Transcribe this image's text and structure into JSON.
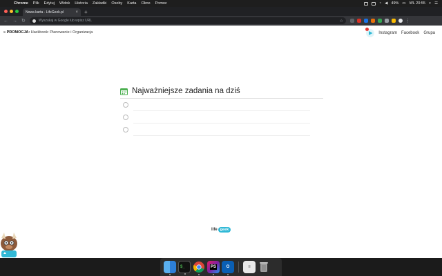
{
  "menubar": {
    "app": "Chrome",
    "items": [
      "Plik",
      "Edytuj",
      "Widok",
      "Historia",
      "Zakładki",
      "Osoby",
      "Karta",
      "Okno",
      "Pomoc"
    ],
    "battery": "49%",
    "clock": "WL 20:55"
  },
  "browser": {
    "tab_title": "Nowa karta - LifeGeek.pl",
    "omnibox_placeholder": "Wyszukaj w Google lub wpisz URL"
  },
  "page": {
    "promo_prefix": "» PROMOCJA:",
    "promo_text": "Hackbook: Planowanie i Organizacja",
    "links": [
      "Instagram",
      "Facebook",
      "Grupa"
    ],
    "tasks_title": "Najważniejsze zadania na dziś",
    "tasks": [
      "",
      "",
      ""
    ],
    "footer_life": "life",
    "footer_geek": "geek"
  },
  "colors": {
    "accent_green": "#4caf50",
    "accent_cyan": "#31b9d6",
    "menubar_bg": "#1e1e1e",
    "toolbar_bg": "#35363a"
  },
  "dock": {
    "apps": [
      "finder-icon",
      "terminal-icon",
      "chrome-icon",
      "phpstorm-icon",
      "outlook-icon",
      "preview-icon",
      "trash-icon"
    ]
  }
}
